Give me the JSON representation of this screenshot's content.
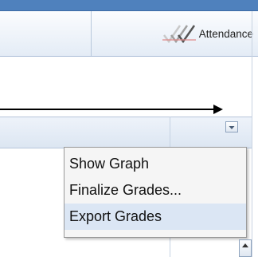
{
  "toolbar": {
    "attendance_label": "Attendance",
    "attendance_icon": "checkmarks-icon"
  },
  "column_menu": {
    "items": [
      {
        "label": "Show Graph"
      },
      {
        "label": "Finalize Grades..."
      },
      {
        "label": "Export Grades"
      }
    ],
    "highlighted_index": 2
  },
  "colors": {
    "header_strip": "#4f81bd",
    "menu_highlight": "#dbe6f4",
    "toolbar_bg": "#e4ecf6"
  }
}
